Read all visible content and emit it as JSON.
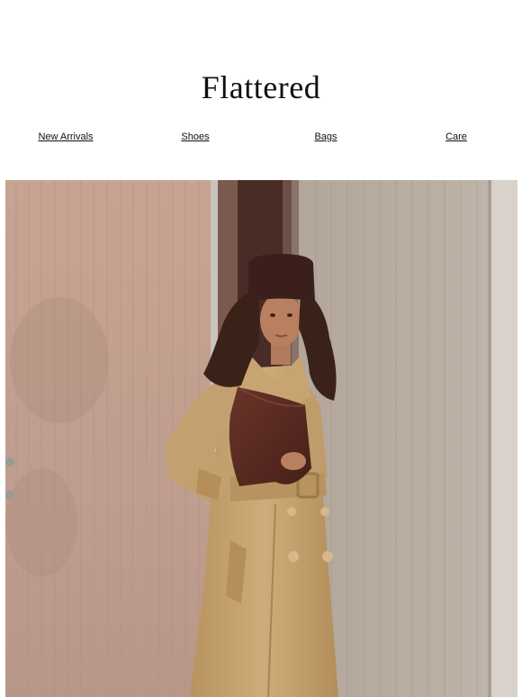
{
  "brand": {
    "name": "Flattered"
  },
  "nav": {
    "items": [
      {
        "label": "New Arrivals"
      },
      {
        "label": "Shoes"
      },
      {
        "label": "Bags"
      },
      {
        "label": "Care"
      }
    ]
  },
  "hero": {
    "image_subject": "model-in-trench-coat-with-leather-clutch",
    "colors": {
      "door": "#c7a596",
      "wall": "#b7aba0",
      "coat": "#c9a677",
      "bag": "#5a2a22",
      "hat": "#3b1f1c",
      "hair": "#3a2218"
    }
  }
}
